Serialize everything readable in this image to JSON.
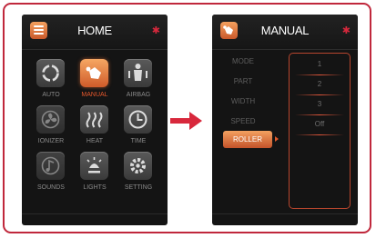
{
  "colors": {
    "frame": "#c0283c",
    "accent": "#e8582c",
    "screen_bg": "#141414",
    "arrow": "#d8283c"
  },
  "home": {
    "title": "HOME",
    "tiles": [
      {
        "label": "AUTO",
        "icon": "auto-cycle-icon",
        "active": false
      },
      {
        "label": "MANUAL",
        "icon": "hand-touch-icon",
        "active": true
      },
      {
        "label": "AIRBAG",
        "icon": "airbag-body-icon",
        "active": false
      },
      {
        "label": "IONIZER",
        "icon": "ionizer-fan-icon",
        "active": false
      },
      {
        "label": "HEAT",
        "icon": "heat-waves-icon",
        "active": false
      },
      {
        "label": "TIME",
        "icon": "clock-icon",
        "active": false
      },
      {
        "label": "SOUNDS",
        "icon": "music-note-icon",
        "active": false
      },
      {
        "label": "LIGHTS",
        "icon": "lamp-icon",
        "active": false
      },
      {
        "label": "SETTING",
        "icon": "gear-icon",
        "active": false
      }
    ]
  },
  "manual": {
    "title": "MANUAL",
    "rows": [
      {
        "label": "MODE",
        "value": "1"
      },
      {
        "label": "PART",
        "value": "2"
      },
      {
        "label": "WIDTH",
        "value": "3"
      },
      {
        "label": "SPEED",
        "value": "Off"
      }
    ],
    "roller_label": "ROLLER"
  }
}
